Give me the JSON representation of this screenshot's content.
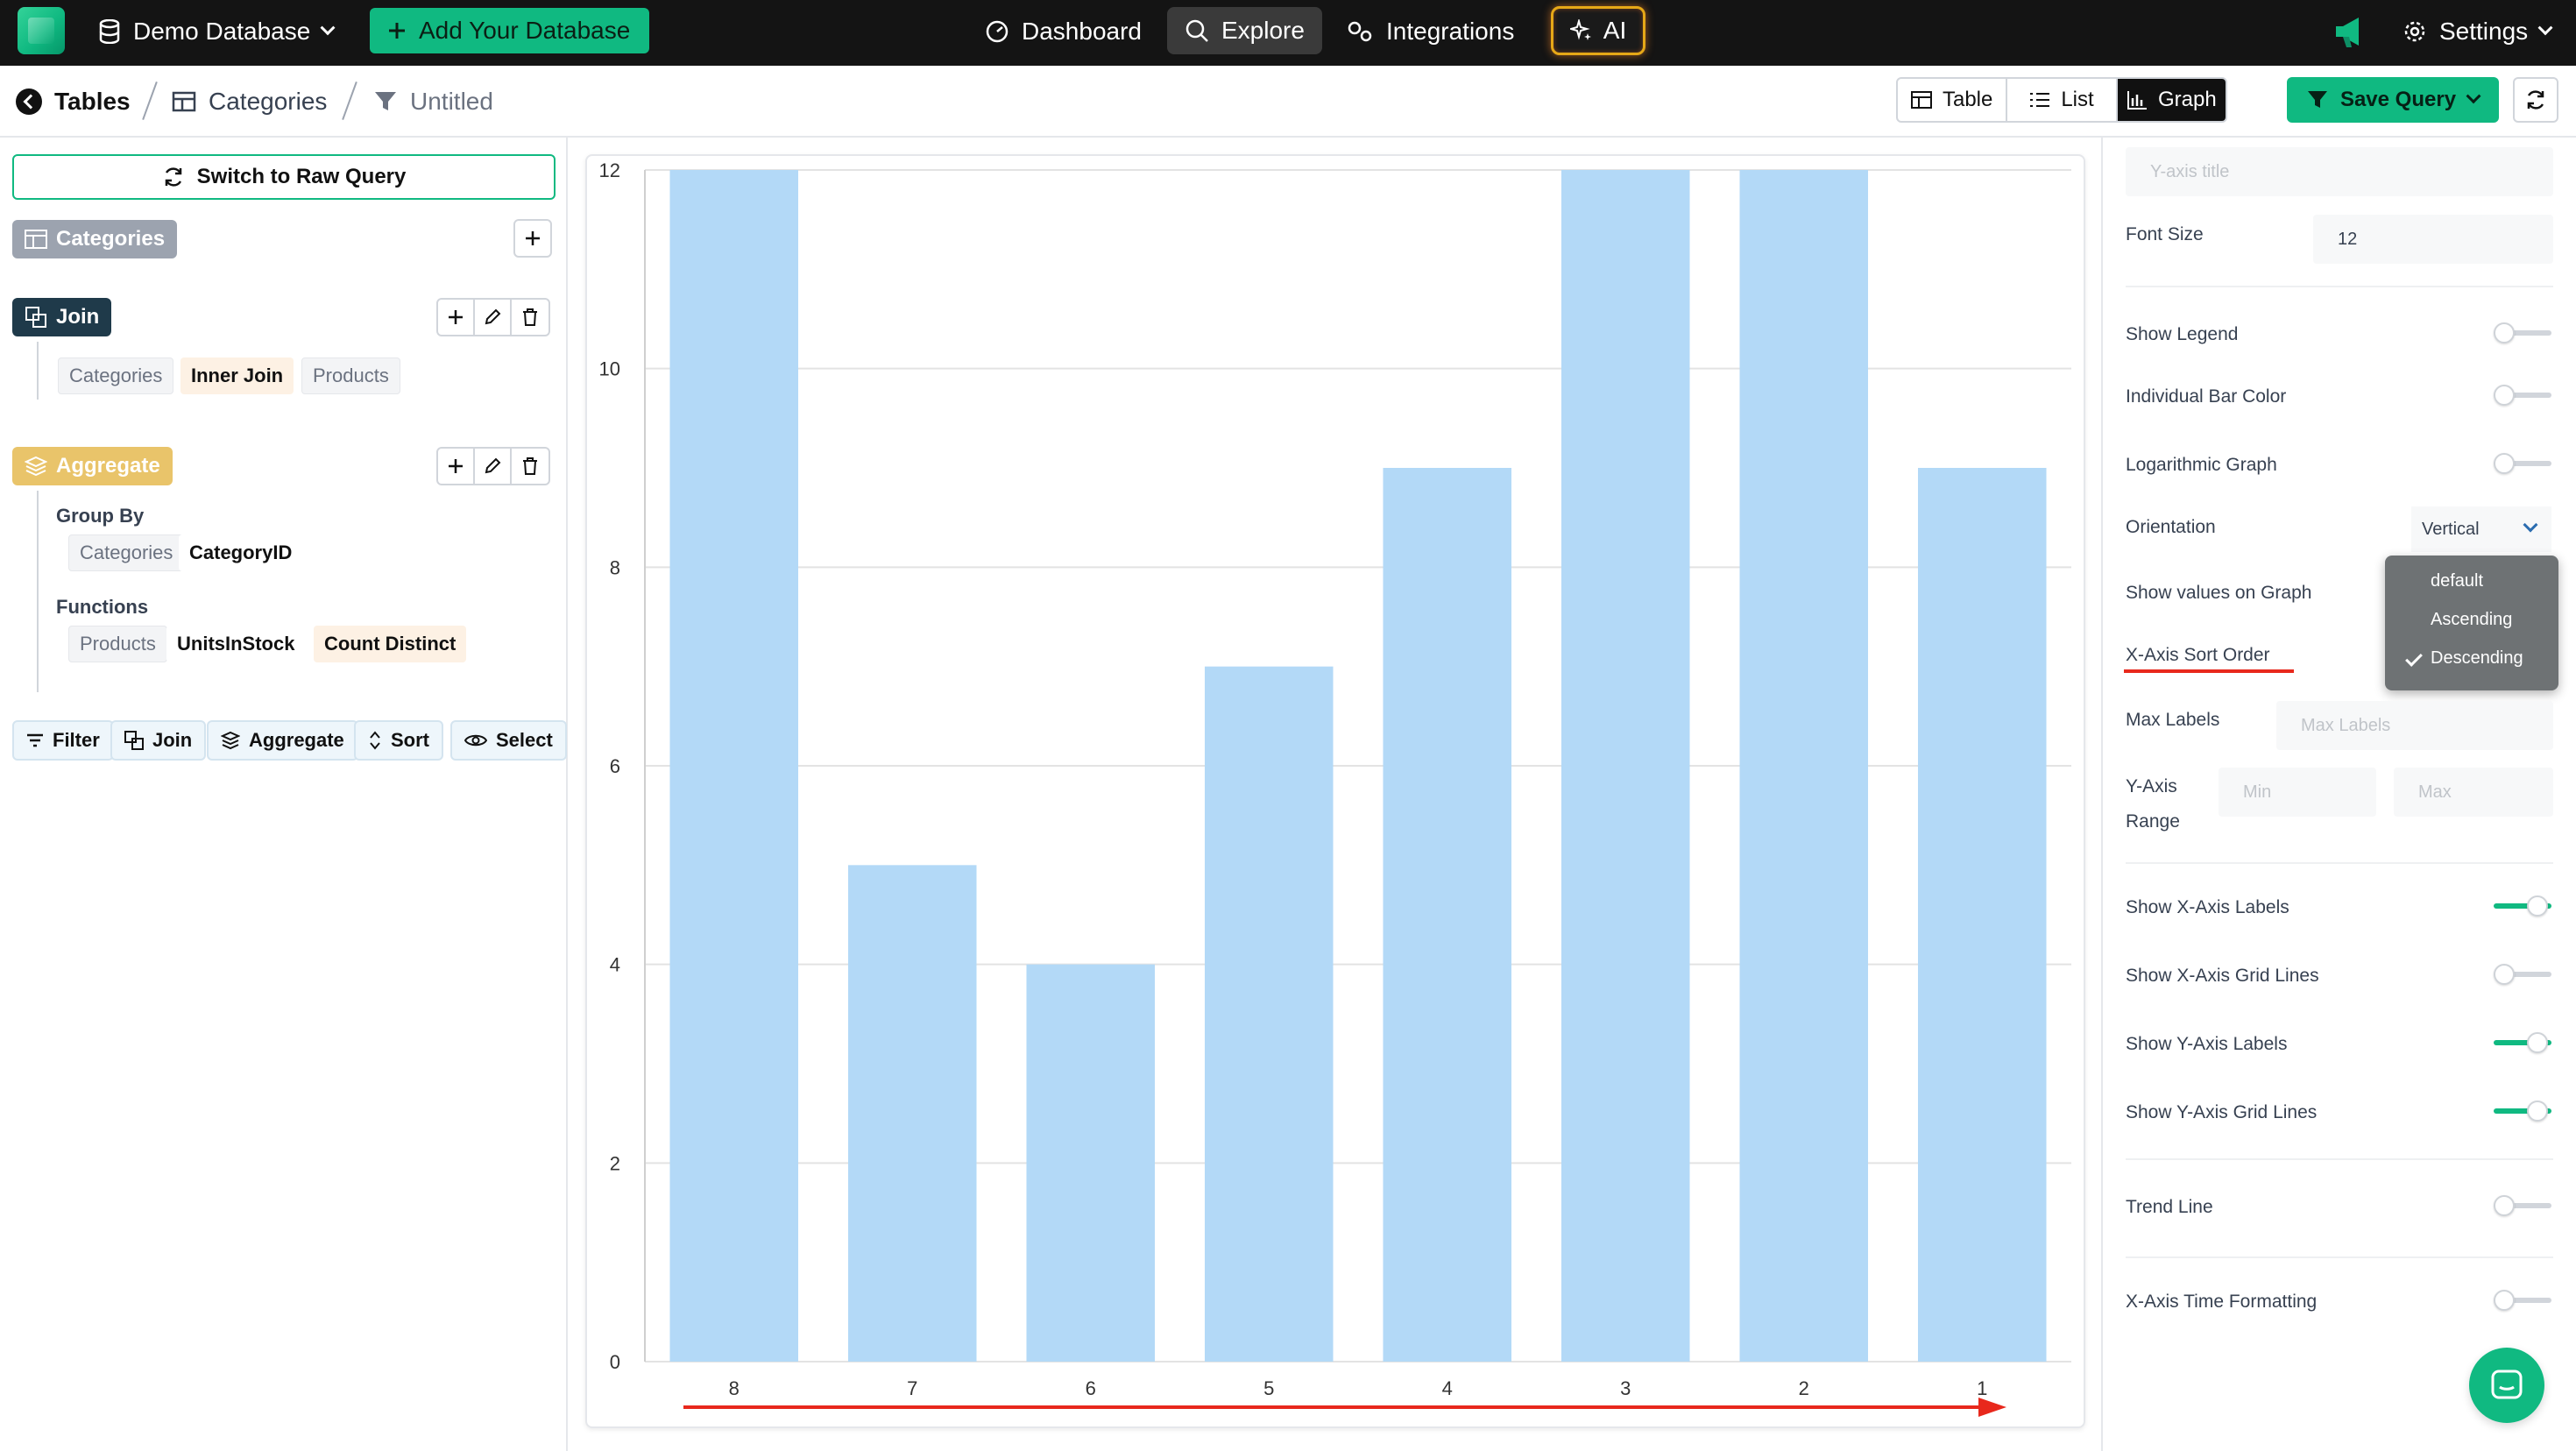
{
  "topbar": {
    "database": "Demo Database",
    "add_database": "Add Your Database",
    "nav": {
      "dashboard": "Dashboard",
      "explore": "Explore",
      "integrations": "Integrations",
      "ai": "AI"
    },
    "settings": "Settings"
  },
  "breadcrumb": {
    "tables": "Tables",
    "categories": "Categories",
    "untitled": "Untitled"
  },
  "view_toggle": {
    "table": "Table",
    "list": "List",
    "graph": "Graph"
  },
  "save_query": "Save Query",
  "left": {
    "switch_raw": "Switch to Raw Query",
    "source_table": "Categories",
    "join": {
      "label": "Join",
      "left_table": "Categories",
      "type": "Inner Join",
      "right_table": "Products"
    },
    "aggregate": {
      "label": "Aggregate",
      "group_by_label": "Group By",
      "group_by_table": "Categories",
      "group_by_column": "CategoryID",
      "functions_label": "Functions",
      "fn_table": "Products",
      "fn_column": "UnitsInStock",
      "fn_op": "Count Distinct"
    },
    "ops": {
      "filter": "Filter",
      "join": "Join",
      "aggregate": "Aggregate",
      "sort": "Sort",
      "select": "Select"
    }
  },
  "chart_data": {
    "type": "bar",
    "categories": [
      "8",
      "7",
      "6",
      "5",
      "4",
      "3",
      "2",
      "1"
    ],
    "values": [
      12,
      5,
      4,
      7,
      9,
      12,
      12,
      9
    ],
    "ylim": [
      0,
      12
    ],
    "yticks": [
      "0",
      "2",
      "4",
      "6",
      "8",
      "10",
      "12"
    ],
    "grid": "horizontal",
    "bar_color": "#b3d9f7",
    "annotation_color": "#e8281c"
  },
  "settings_panel": {
    "y_axis_title_placeholder": "Y-axis title",
    "font_size_label": "Font Size",
    "font_size_value": "12",
    "show_legend": "Show Legend",
    "individual_bar_color": "Individual Bar Color",
    "logarithmic_graph": "Logarithmic Graph",
    "orientation_label": "Orientation",
    "orientation_value": "Vertical",
    "show_values": "Show values on Graph",
    "x_sort_label": "X-Axis Sort Order",
    "sort_options": [
      "default",
      "Ascending",
      "Descending"
    ],
    "sort_selected": "Descending",
    "max_labels_label": "Max Labels",
    "max_labels_placeholder": "Max Labels",
    "y_range_label_1": "Y-Axis",
    "y_range_label_2": "Range",
    "min_placeholder": "Min",
    "max_placeholder": "Max",
    "show_x_labels": "Show X-Axis Labels",
    "show_x_grid": "Show X-Axis Grid Lines",
    "show_y_labels": "Show Y-Axis Labels",
    "show_y_grid": "Show Y-Axis Grid Lines",
    "trend_line": "Trend Line",
    "x_time_format": "X-Axis Time Formatting"
  },
  "colors": {
    "accent": "#10b981",
    "topbar": "#141414",
    "ai_border": "#e6a817"
  }
}
